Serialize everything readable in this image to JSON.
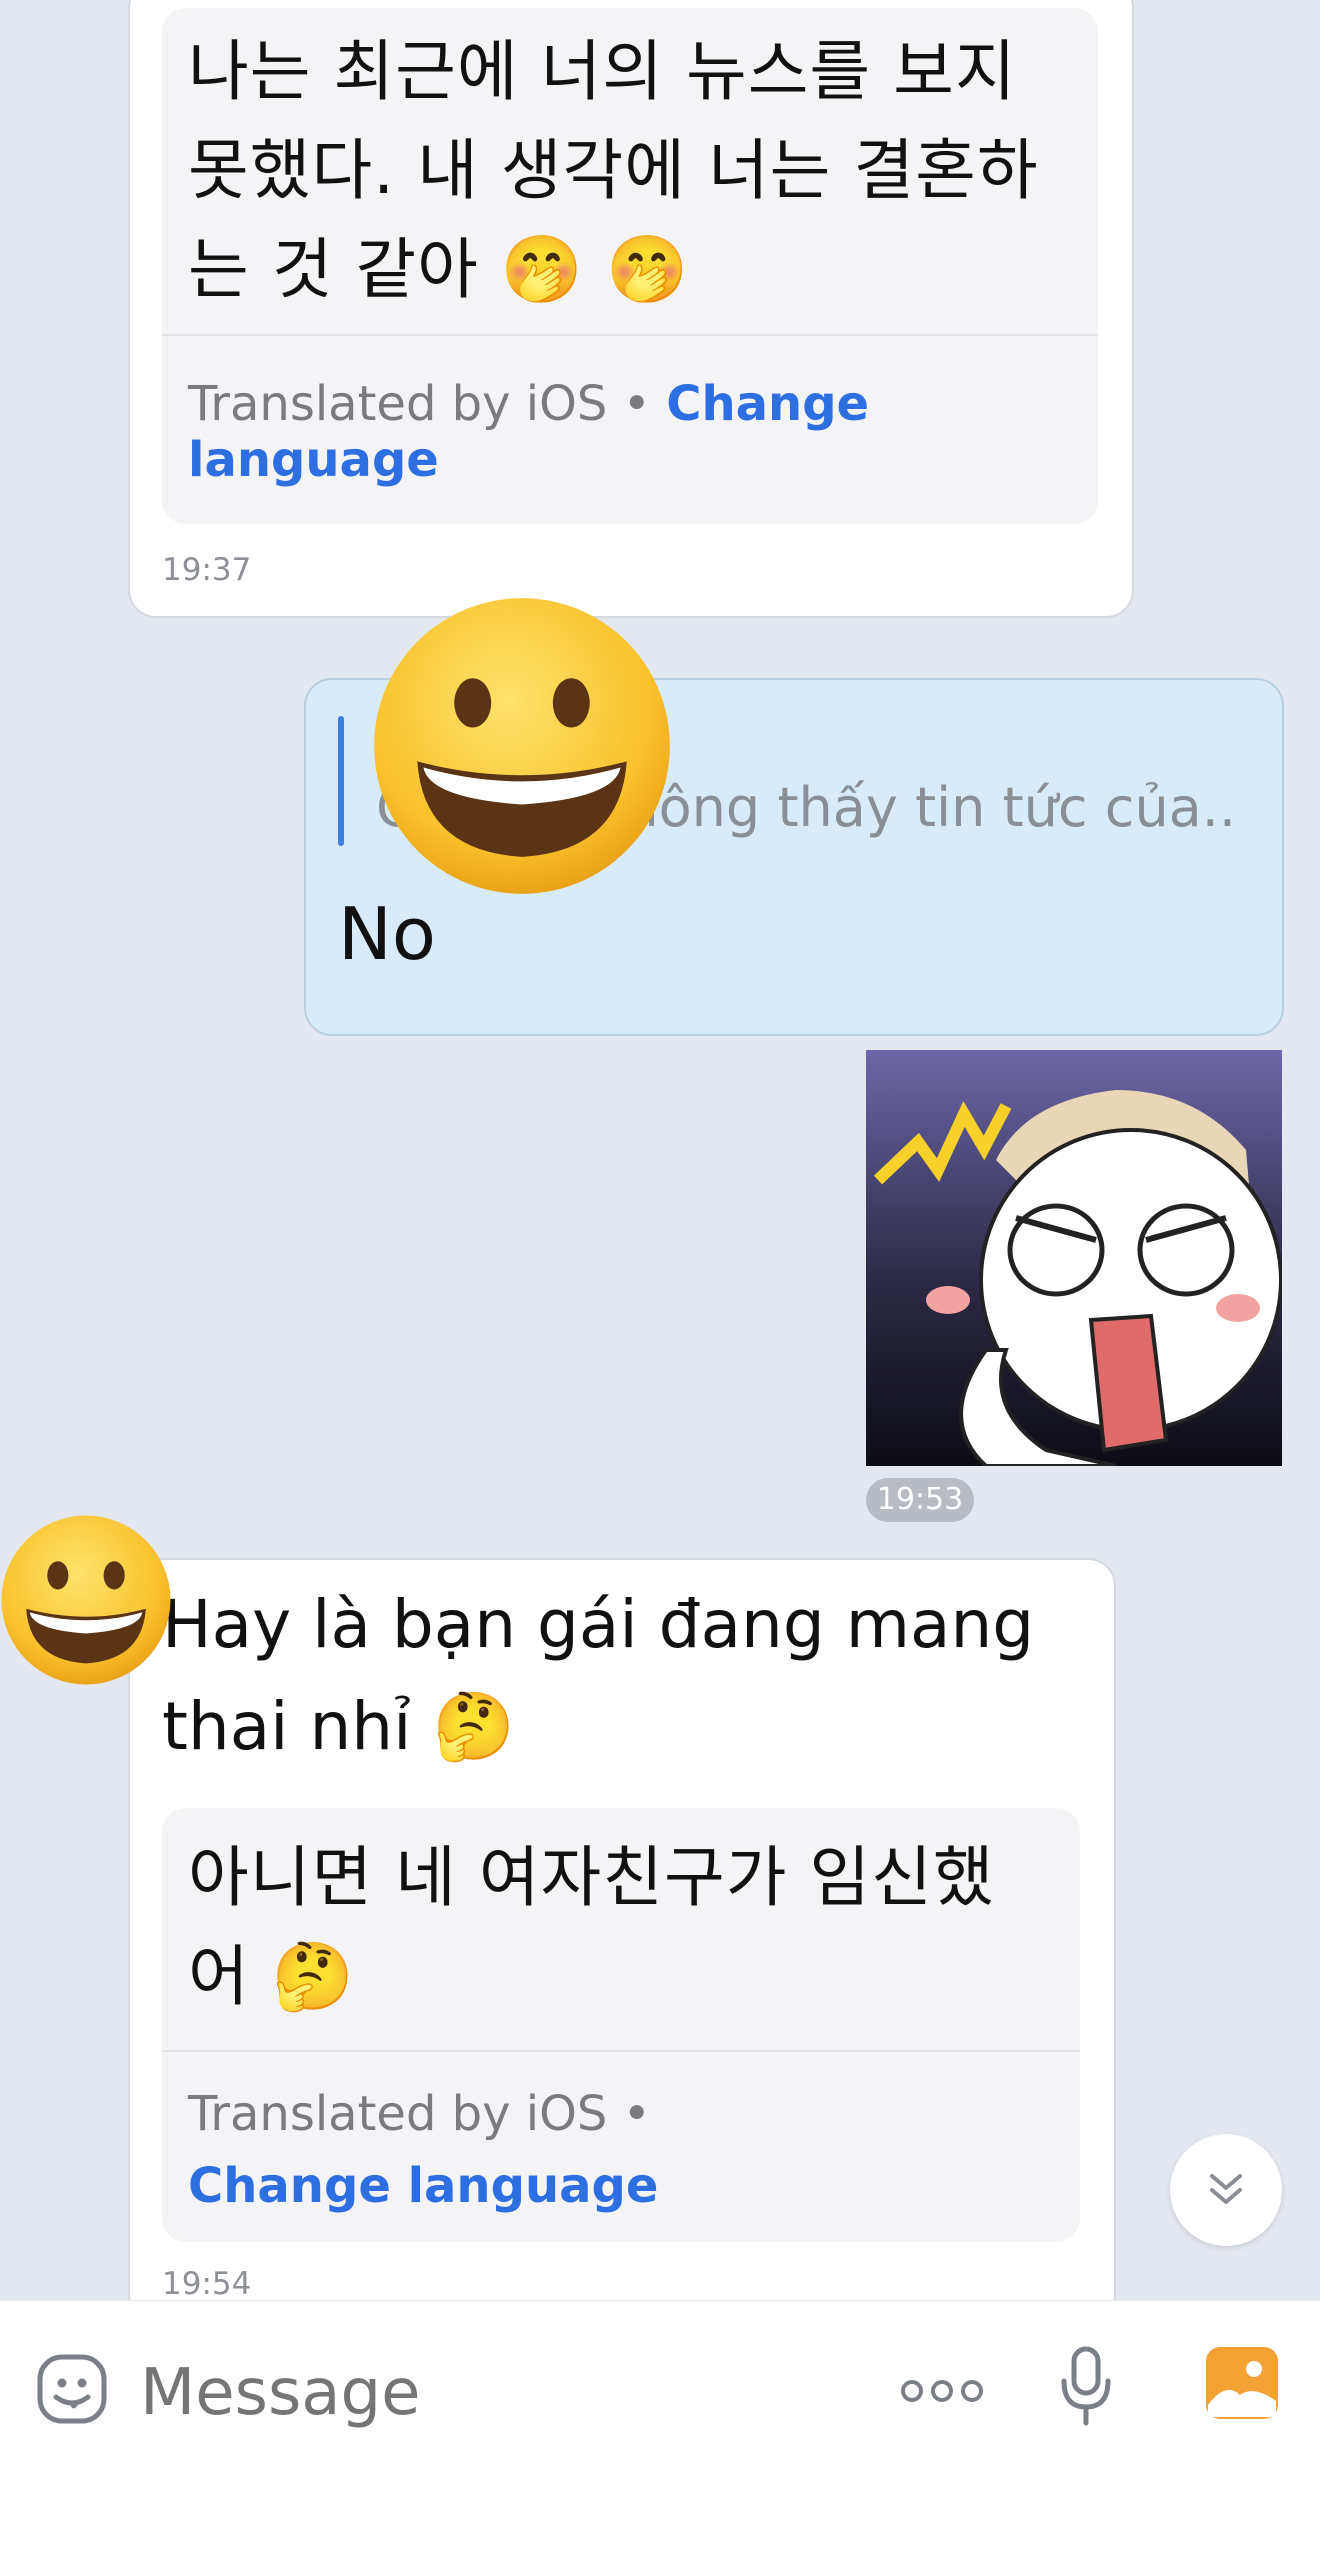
{
  "messages": {
    "msg1": {
      "translation": "나는 최근에 너의 뉴스를 보지 못했다. 내 생각에 너는 결혼하는 것 같아 🤭 🤭",
      "translated_by": "Translated by iOS •",
      "change_language": "Change language",
      "time": "19:37"
    },
    "msg2": {
      "quote": "Chắc là không thấy tin tức của...",
      "text": "No"
    },
    "sticker": {
      "time": "19:53"
    },
    "msg3": {
      "text": "Hay là bạn gái đang mang thai nhỉ 🤔",
      "translation": "아니면 네 여자친구가 임신했어 🤔",
      "translated_by": "Translated by iOS •",
      "change_language": "Change language",
      "time": "19:54"
    }
  },
  "input": {
    "placeholder": "Message"
  },
  "colors": {
    "background": "#e3e7ef",
    "incoming": "#ffffff",
    "outgoing": "#d8ebfa",
    "link": "#2d6fe0"
  }
}
